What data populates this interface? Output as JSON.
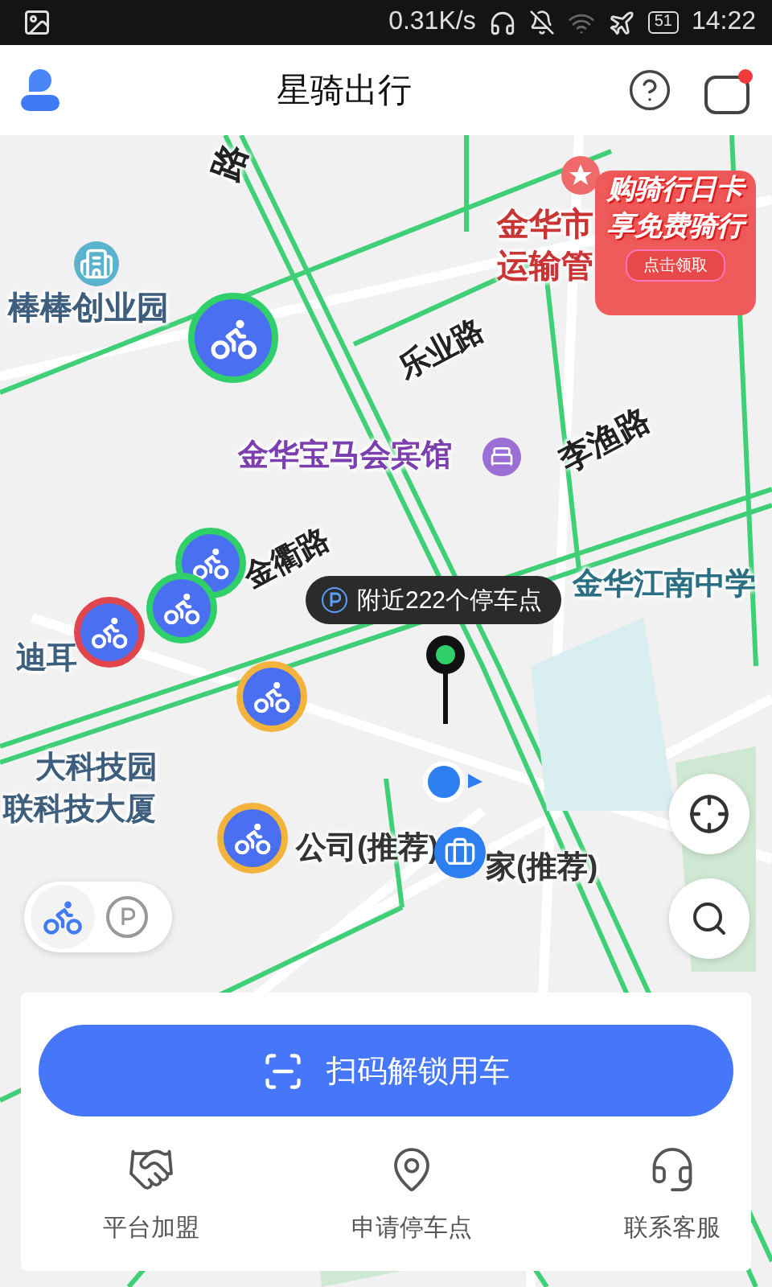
{
  "status_bar": {
    "speed": "0.31K/s",
    "battery": "51",
    "time": "14:22"
  },
  "header": {
    "title": "星骑出行",
    "has_unread": true
  },
  "map": {
    "labels": [
      {
        "text": "路",
        "kind": "road"
      },
      {
        "text": "棒棒创业园",
        "kind": "place"
      },
      {
        "text": "金华市",
        "kind": "gov"
      },
      {
        "text": "运输管",
        "kind": "gov"
      },
      {
        "text": "乐业路",
        "kind": "road"
      },
      {
        "text": "金华宝马会宾馆",
        "kind": "hotel"
      },
      {
        "text": "李渔路",
        "kind": "road"
      },
      {
        "text": "金衢路",
        "kind": "road"
      },
      {
        "text": "金华江南中学",
        "kind": "school"
      },
      {
        "text": "迪耳",
        "kind": "place"
      },
      {
        "text": "大科技园",
        "kind": "place"
      },
      {
        "text": "联科技大厦",
        "kind": "place"
      },
      {
        "text": "公司(推荐)",
        "kind": "recommend"
      },
      {
        "text": "家(推荐)",
        "kind": "recommend"
      }
    ],
    "promo": {
      "line1": "购骑行日卡",
      "line2": "享免费骑行",
      "cta": "点击领取"
    },
    "parking_hint": "附近222个停车点",
    "bike_markers": [
      {
        "color": "#2fd06a"
      },
      {
        "color": "#2fd06a"
      },
      {
        "color": "#2fd06a"
      },
      {
        "color": "#e0464c"
      },
      {
        "color": "#f2b43c"
      },
      {
        "color": "#f2b43c"
      }
    ],
    "layer_toggle": [
      {
        "kind": "bike",
        "selected": true
      },
      {
        "kind": "parking",
        "selected": false
      }
    ]
  },
  "panel": {
    "button": "扫码解锁用车",
    "actions": [
      {
        "kind": "join",
        "label": "平台加盟"
      },
      {
        "kind": "parking",
        "label": "申请停车点"
      },
      {
        "kind": "service",
        "label": "联系客服"
      }
    ]
  }
}
